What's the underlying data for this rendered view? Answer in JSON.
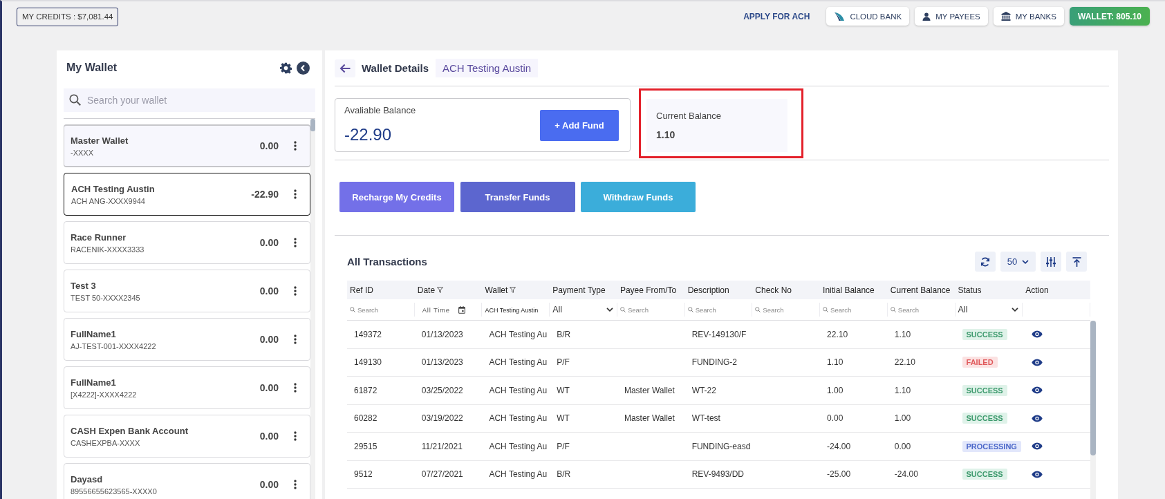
{
  "top_bar": {
    "credits": "MY CREDITS : $7,081.44",
    "actions": [
      {
        "kind": "link",
        "label": "APPLY FOR ACH"
      },
      {
        "kind": "cloud",
        "label": "CLOUD BANK"
      },
      {
        "kind": "payees",
        "label": "MY PAYEES"
      },
      {
        "kind": "banks",
        "label": "MY BANKS"
      },
      {
        "kind": "wallet",
        "label": "WALLET: 805.10"
      }
    ]
  },
  "sidebar": {
    "title": "My Wallet",
    "search": {
      "placeholder": "Search your wallet"
    },
    "wallets": [
      {
        "name": "Master Wallet",
        "account": "-XXXX",
        "balance": "0.00",
        "selected": false,
        "highlighted": true
      },
      {
        "name": "ACH Testing Austin",
        "account": "ACH ANG-XXXX9944",
        "balance": "-22.90",
        "selected": true,
        "highlighted": false
      },
      {
        "name": "Race Runner",
        "account": "RACENIK-XXXX3333",
        "balance": "0.00",
        "selected": false,
        "highlighted": false
      },
      {
        "name": "Test 3",
        "account": "TEST 50-XXXX2345",
        "balance": "0.00",
        "selected": false,
        "highlighted": false
      },
      {
        "name": "FullName1",
        "account": "AJ-TEST-001-XXXX4222",
        "balance": "0.00",
        "selected": false,
        "highlighted": false
      },
      {
        "name": "FullName1",
        "account": "[X4222]-XXXX4222",
        "balance": "0.00",
        "selected": false,
        "highlighted": false
      },
      {
        "name": "CASH Expen Bank Account",
        "account": "CASHEXPBA-XXXX",
        "balance": "0.00",
        "selected": false,
        "highlighted": false
      },
      {
        "name": "Dayasd",
        "account": "89556655623565-XXXX0",
        "balance": "0.00",
        "selected": false,
        "highlighted": false
      }
    ]
  },
  "details": {
    "title": "Wallet Details",
    "wallet_name": "ACH Testing Austin",
    "available_balance": {
      "label": "Avaliable Balance",
      "amount": "-22.90",
      "button": "+ Add Fund"
    },
    "current_balance": {
      "label": "Current Balance",
      "amount": "1.10",
      "highlighted": true
    },
    "actions": [
      {
        "label": "Recharge My Credits",
        "color": "#7370e8"
      },
      {
        "label": "Transfer Funds",
        "color": "#5c66cf"
      },
      {
        "label": "Withdraw Funds",
        "color": "#3badda"
      }
    ]
  },
  "transactions": {
    "title": "All Transactions",
    "page_size": "50",
    "columns": [
      {
        "label": "Ref ID",
        "filter_menu": false,
        "filter": {
          "kind": "search",
          "placeholder": "Search"
        }
      },
      {
        "label": "Date",
        "filter_menu": true,
        "filter": {
          "kind": "date",
          "value": "All Time"
        }
      },
      {
        "label": "Wallet",
        "filter_menu": true,
        "filter": {
          "kind": "text",
          "value": "ACH Testing Austin"
        }
      },
      {
        "label": "Payment Type",
        "filter_menu": false,
        "filter": {
          "kind": "select",
          "value": "All"
        }
      },
      {
        "label": "Payee From/To",
        "filter_menu": false,
        "filter": {
          "kind": "search",
          "placeholder": "Search"
        }
      },
      {
        "label": "Description",
        "filter_menu": false,
        "filter": {
          "kind": "search",
          "placeholder": "Search"
        }
      },
      {
        "label": "Check No",
        "filter_menu": false,
        "filter": {
          "kind": "search",
          "placeholder": "Search"
        }
      },
      {
        "label": "Initial Balance",
        "filter_menu": false,
        "filter": {
          "kind": "search",
          "placeholder": "Search"
        }
      },
      {
        "label": "Current Balance",
        "filter_menu": false,
        "filter": {
          "kind": "search",
          "placeholder": "Search"
        }
      },
      {
        "label": "Status",
        "filter_menu": false,
        "filter": {
          "kind": "select",
          "value": "All"
        }
      },
      {
        "label": "Action",
        "filter_menu": false
      }
    ],
    "rows": [
      {
        "ref_id": "149372",
        "date": "01/13/2023",
        "wallet": "ACH Testing Au",
        "payment_type": "B/R",
        "description": "REV-149130/F",
        "initial_balance": "22.10",
        "current_balance": "1.10",
        "status": {
          "label": "SUCCESS",
          "kind": "success"
        }
      },
      {
        "ref_id": "149130",
        "date": "01/13/2023",
        "wallet": "ACH Testing Au",
        "payment_type": "P/F",
        "description": "FUNDING-2",
        "initial_balance": "1.10",
        "current_balance": "22.10",
        "status": {
          "label": "FAILED",
          "kind": "failed"
        }
      },
      {
        "ref_id": "61872",
        "date": "03/25/2022",
        "wallet": "ACH Testing Au",
        "payment_type": "WT",
        "payee": "Master Wallet",
        "description": "WT-22",
        "initial_balance": "1.00",
        "current_balance": "1.10",
        "status": {
          "label": "SUCCESS",
          "kind": "success"
        }
      },
      {
        "ref_id": "60282",
        "date": "03/19/2022",
        "wallet": "ACH Testing Au",
        "payment_type": "WT",
        "payee": "Master Wallet",
        "description": "WT-test",
        "initial_balance": "0.00",
        "current_balance": "1.00",
        "status": {
          "label": "SUCCESS",
          "kind": "success"
        }
      },
      {
        "ref_id": "29515",
        "date": "11/21/2021",
        "wallet": "ACH Testing Au",
        "payment_type": "P/F",
        "description": "FUNDING-easd",
        "initial_balance": "-24.00",
        "current_balance": "0.00",
        "status": {
          "label": "PROCESSING",
          "kind": "processing"
        }
      },
      {
        "ref_id": "9512",
        "date": "07/27/2021",
        "wallet": "ACH Testing Au",
        "payment_type": "B/R",
        "description": "REV-9493/DD",
        "initial_balance": "-25.00",
        "current_balance": "-24.00",
        "status": {
          "label": "SUCCESS",
          "kind": "success"
        }
      }
    ]
  }
}
